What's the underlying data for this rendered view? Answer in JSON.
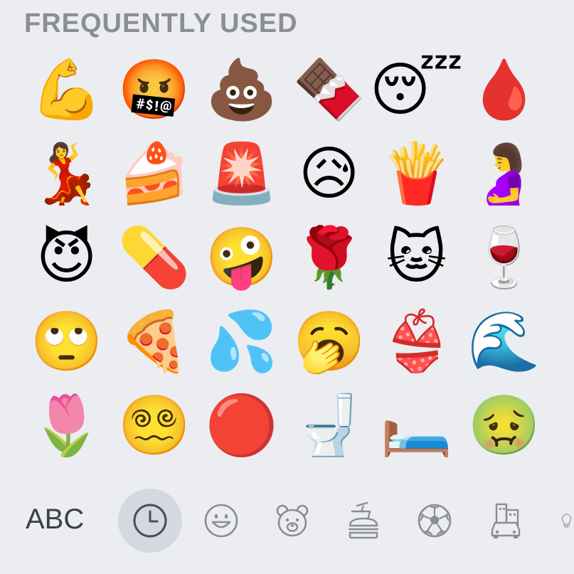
{
  "section": {
    "title": "FREQUENTLY USED"
  },
  "emojis": [
    "💪",
    "🤬",
    "💩",
    "🍫",
    "😴",
    "🩸",
    "💃",
    "🍰",
    "🚨",
    "😥",
    "🍟",
    "🤰",
    "😈",
    "💊",
    "🤪",
    "🌹",
    "🐱",
    "🍷",
    "🙄",
    "🍕",
    "💦",
    "🥱",
    "👙",
    "🌊",
    "🌷",
    "😵‍💫",
    "🔴",
    "🚽",
    "🛏️",
    "🤢"
  ],
  "category_bar": {
    "abc_label": "ABC",
    "categories": [
      {
        "name": "recent",
        "icon": "clock-icon",
        "selected": true
      },
      {
        "name": "smileys",
        "icon": "smiley-icon",
        "selected": false
      },
      {
        "name": "animals",
        "icon": "bear-icon",
        "selected": false
      },
      {
        "name": "food",
        "icon": "burger-icon",
        "selected": false
      },
      {
        "name": "activity",
        "icon": "soccer-ball-icon",
        "selected": false
      },
      {
        "name": "travel",
        "icon": "city-car-icon",
        "selected": false
      },
      {
        "name": "objects",
        "icon": "lightbulb-icon",
        "selected": false
      }
    ]
  },
  "colors": {
    "background": "#ebedf1",
    "title": "#8b8e94",
    "icon": "#8a8d93",
    "selected_icon": "#4a4d55",
    "selected_bg": "#d4d8df"
  }
}
